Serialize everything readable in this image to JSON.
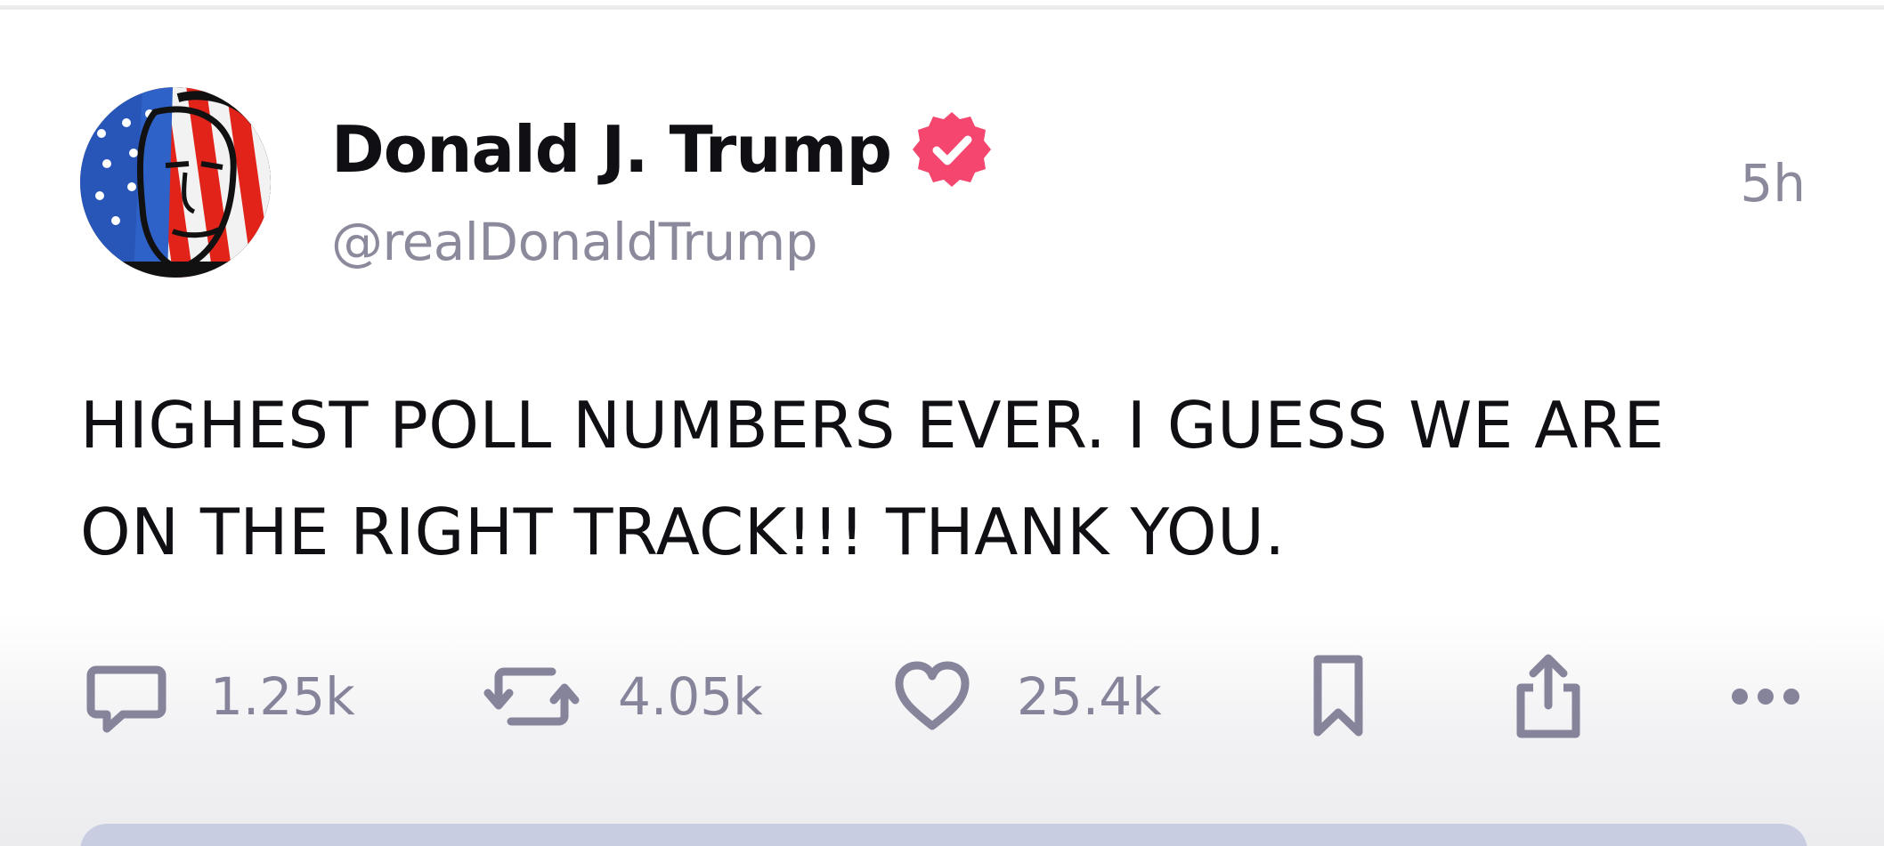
{
  "post": {
    "author": {
      "display_name": "Donald J. Trump",
      "handle": "@realDonaldTrump",
      "verified": true,
      "avatar_icon": "flag-portrait-avatar"
    },
    "timestamp": "5h",
    "text_line_1": "HIGHEST POLL NUMBERS EVER. I GUESS WE ARE",
    "text_line_2": "ON THE RIGHT TRACK!!! THANK YOU.",
    "actions": {
      "replies": {
        "count": "1.25k",
        "icon": "comment-icon"
      },
      "reposts": {
        "count": "4.05k",
        "icon": "repost-icon"
      },
      "likes": {
        "count": "25.4k",
        "icon": "heart-icon"
      },
      "bookmark": {
        "icon": "bookmark-icon"
      },
      "share": {
        "icon": "share-icon"
      },
      "more": {
        "icon": "more-icon"
      }
    }
  },
  "colors": {
    "text_primary": "#0f0f14",
    "text_secondary": "#8b8a9c",
    "icon_gray": "#85849a",
    "verified_badge": "#f4466f",
    "divider": "#ececef"
  }
}
